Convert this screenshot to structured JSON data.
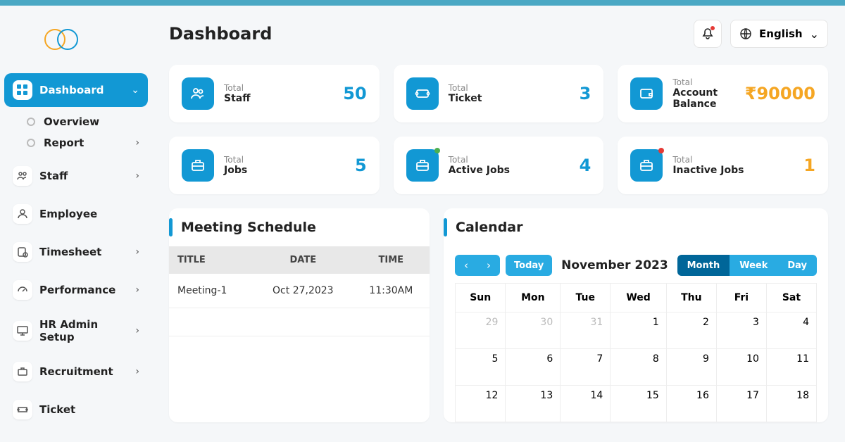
{
  "header": {
    "title": "Dashboard",
    "language": "English"
  },
  "sidebar": {
    "items": [
      {
        "label": "Dashboard"
      },
      {
        "label": "Staff"
      },
      {
        "label": "Employee"
      },
      {
        "label": "Timesheet"
      },
      {
        "label": "Performance"
      },
      {
        "label": "HR Admin Setup"
      },
      {
        "label": "Recruitment"
      },
      {
        "label": "Ticket"
      }
    ],
    "dashboard_sub": [
      {
        "label": "Overview"
      },
      {
        "label": "Report"
      }
    ]
  },
  "stats": {
    "staff": {
      "small": "Total",
      "label": "Staff",
      "value": "50"
    },
    "ticket": {
      "small": "Total",
      "label": "Ticket",
      "value": "3"
    },
    "balance": {
      "small": "Total",
      "label": "Account Balance",
      "value": "₹90000"
    },
    "jobs": {
      "small": "Total",
      "label": "Jobs",
      "value": "5"
    },
    "active": {
      "small": "Total",
      "label": "Active Jobs",
      "value": "4"
    },
    "inactive": {
      "small": "Total",
      "label": "Inactive Jobs",
      "value": "1"
    }
  },
  "meeting": {
    "title": "Meeting Schedule",
    "columns": [
      "TITLE",
      "DATE",
      "TIME"
    ],
    "rows": [
      {
        "title": "Meeting-1",
        "date": "Oct 27,2023",
        "time": "11:30AM"
      }
    ]
  },
  "calendar": {
    "title": "Calendar",
    "today": "Today",
    "month_label": "November 2023",
    "views": [
      "Month",
      "Week",
      "Day"
    ],
    "weekdays": [
      "Sun",
      "Mon",
      "Tue",
      "Wed",
      "Thu",
      "Fri",
      "Sat"
    ],
    "rows": [
      [
        {
          "d": "29",
          "o": true
        },
        {
          "d": "30",
          "o": true
        },
        {
          "d": "31",
          "o": true
        },
        {
          "d": "1"
        },
        {
          "d": "2"
        },
        {
          "d": "3"
        },
        {
          "d": "4"
        }
      ],
      [
        {
          "d": "5"
        },
        {
          "d": "6"
        },
        {
          "d": "7"
        },
        {
          "d": "8"
        },
        {
          "d": "9"
        },
        {
          "d": "10"
        },
        {
          "d": "11"
        }
      ],
      [
        {
          "d": "12"
        },
        {
          "d": "13"
        },
        {
          "d": "14"
        },
        {
          "d": "15"
        },
        {
          "d": "16"
        },
        {
          "d": "17"
        },
        {
          "d": "18"
        }
      ]
    ]
  }
}
